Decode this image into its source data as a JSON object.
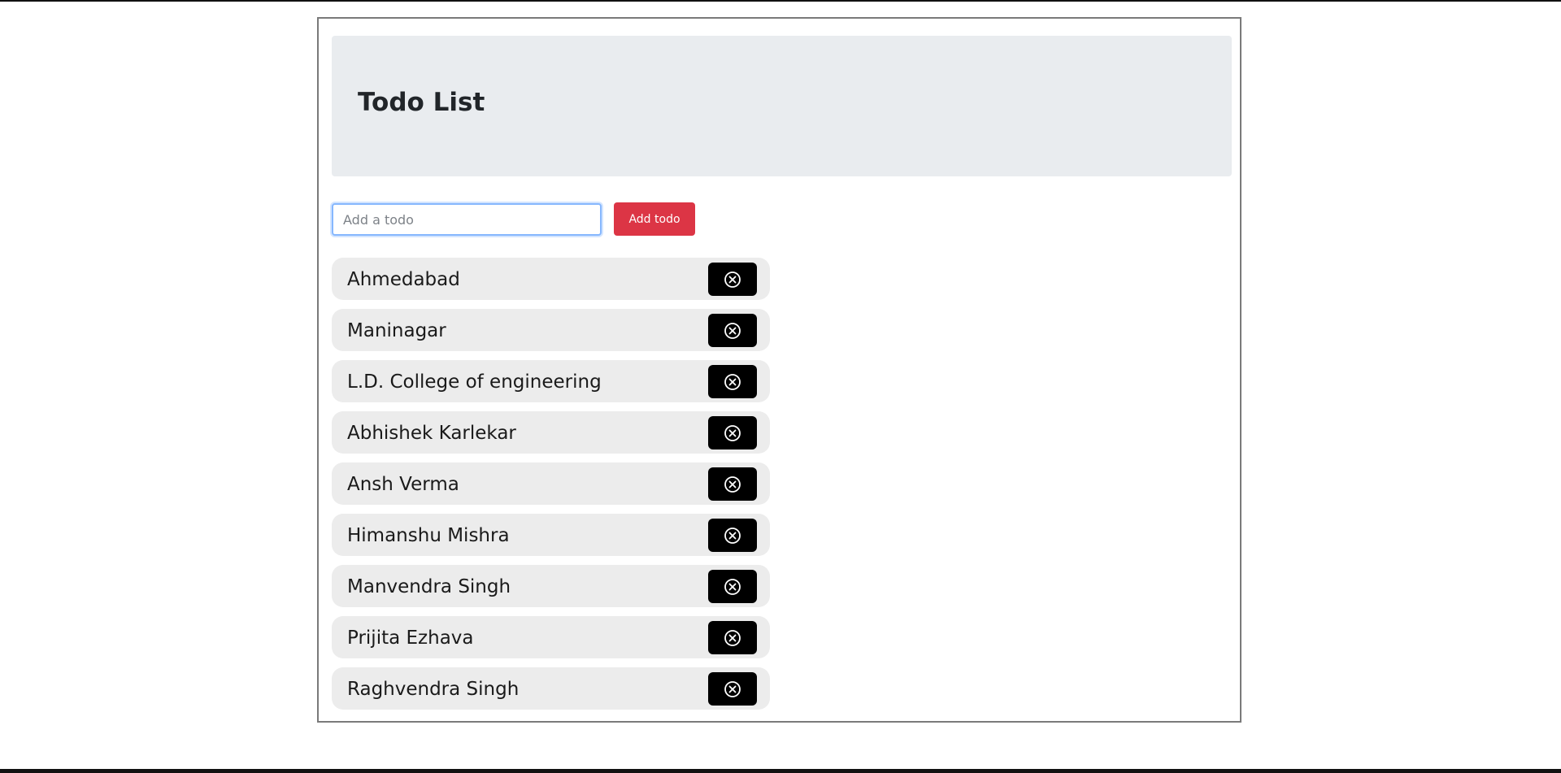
{
  "header": {
    "title": "Todo List"
  },
  "form": {
    "input_placeholder": "Add a todo",
    "input_value": "",
    "add_button_label": "Add todo"
  },
  "colors": {
    "header_bg": "#e9ecef",
    "add_button": "#dc3545",
    "item_bg": "#ececec",
    "delete_button": "#000000"
  },
  "todos": [
    {
      "text": "Ahmedabad",
      "delete_icon": "x-circle-icon"
    },
    {
      "text": "Maninagar",
      "delete_icon": "x-circle-icon"
    },
    {
      "text": "L.D. College of engineering",
      "delete_icon": "x-circle-icon"
    },
    {
      "text": "Abhishek Karlekar",
      "delete_icon": "x-circle-icon"
    },
    {
      "text": "Ansh Verma",
      "delete_icon": "x-circle-icon"
    },
    {
      "text": "Himanshu Mishra",
      "delete_icon": "x-circle-icon"
    },
    {
      "text": "Manvendra Singh",
      "delete_icon": "x-circle-icon"
    },
    {
      "text": "Prijita Ezhava",
      "delete_icon": "x-circle-icon"
    },
    {
      "text": "Raghvendra Singh",
      "delete_icon": "x-circle-icon"
    }
  ]
}
